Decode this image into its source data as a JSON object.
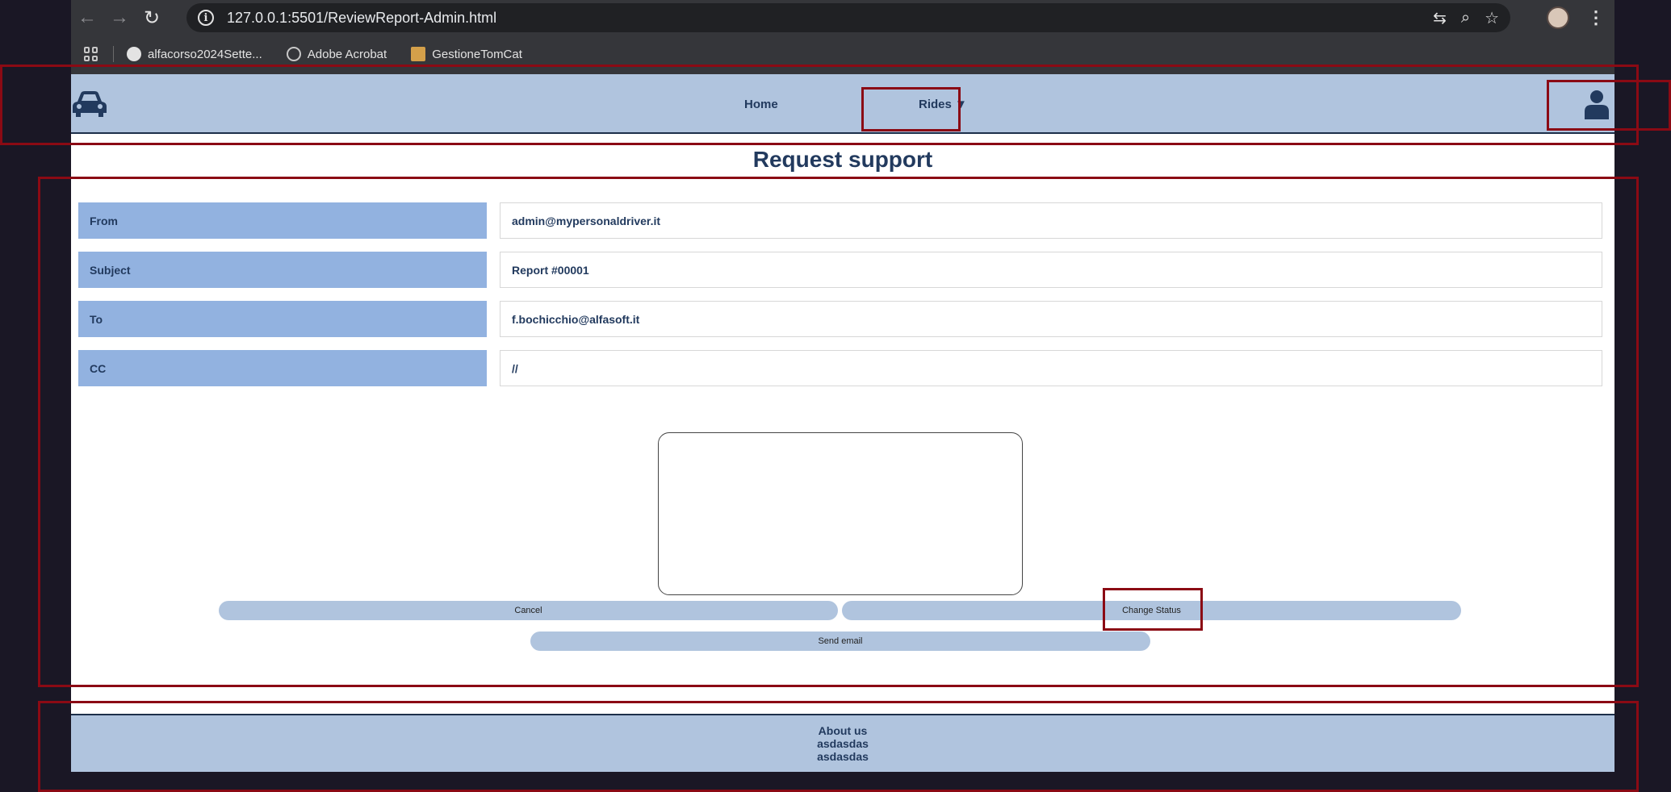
{
  "browser": {
    "url": "127.0.0.1:5501/ReviewReport-Admin.html",
    "bookmarks": [
      {
        "label": "alfacorso2024Sette..."
      },
      {
        "label": "Adobe Acrobat"
      },
      {
        "label": "GestioneTomCat"
      }
    ]
  },
  "nav": {
    "home": "Home",
    "rides": "Rides ▼"
  },
  "page": {
    "title": "Request support"
  },
  "form": {
    "rows": [
      {
        "label": "From",
        "value": "admin@mypersonaldriver.it"
      },
      {
        "label": "Subject",
        "value": "Report #00001"
      },
      {
        "label": "To",
        "value": "f.bochicchio@alfasoft.it"
      },
      {
        "label": "CC",
        "value": "//"
      }
    ],
    "message_value": ""
  },
  "buttons": {
    "cancel": "Cancel",
    "change_status": "Change Status",
    "send_email": "Send email"
  },
  "footer": {
    "lines": [
      "About us",
      "asdasdas",
      "asdasdas"
    ]
  },
  "colors": {
    "header_bg": "#b0c4de",
    "label_bg": "#92b2e0",
    "text_dark": "#223a5e",
    "annotation": "#8b0a14"
  }
}
